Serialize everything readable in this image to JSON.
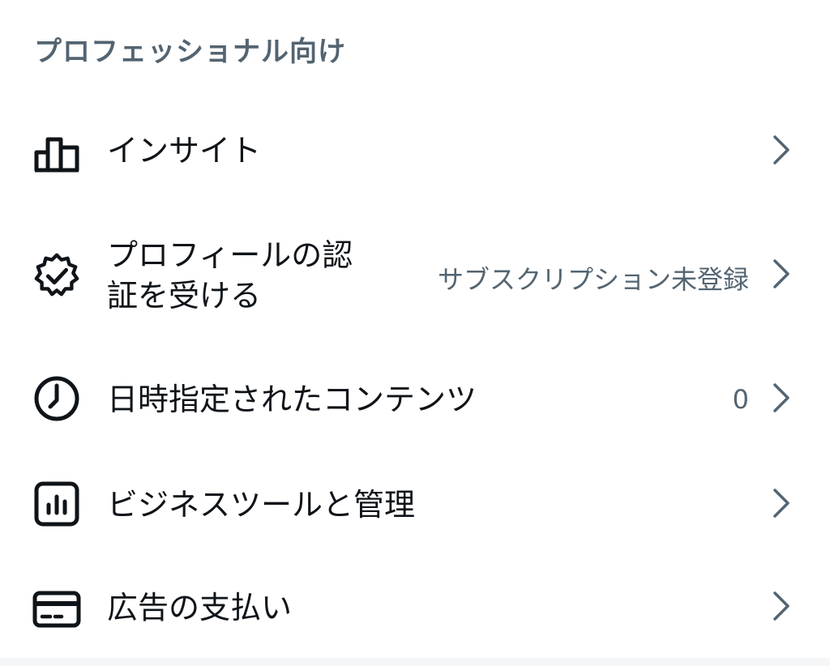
{
  "section": {
    "title": "プロフェッショナル向け"
  },
  "items": [
    {
      "icon": "bar-chart-icon",
      "label": "インサイト",
      "meta": ""
    },
    {
      "icon": "verified-badge-icon",
      "label": "プロフィールの認証を受ける",
      "meta": "サブスクリプション未登録"
    },
    {
      "icon": "clock-icon",
      "label": "日時指定されたコンテンツ",
      "meta": "0"
    },
    {
      "icon": "business-tools-icon",
      "label": "ビジネスツールと管理",
      "meta": ""
    },
    {
      "icon": "credit-card-icon",
      "label": "広告の支払い",
      "meta": ""
    }
  ],
  "colors": {
    "text_primary": "#0f1419",
    "text_secondary": "#536471",
    "background": "#ffffff"
  }
}
